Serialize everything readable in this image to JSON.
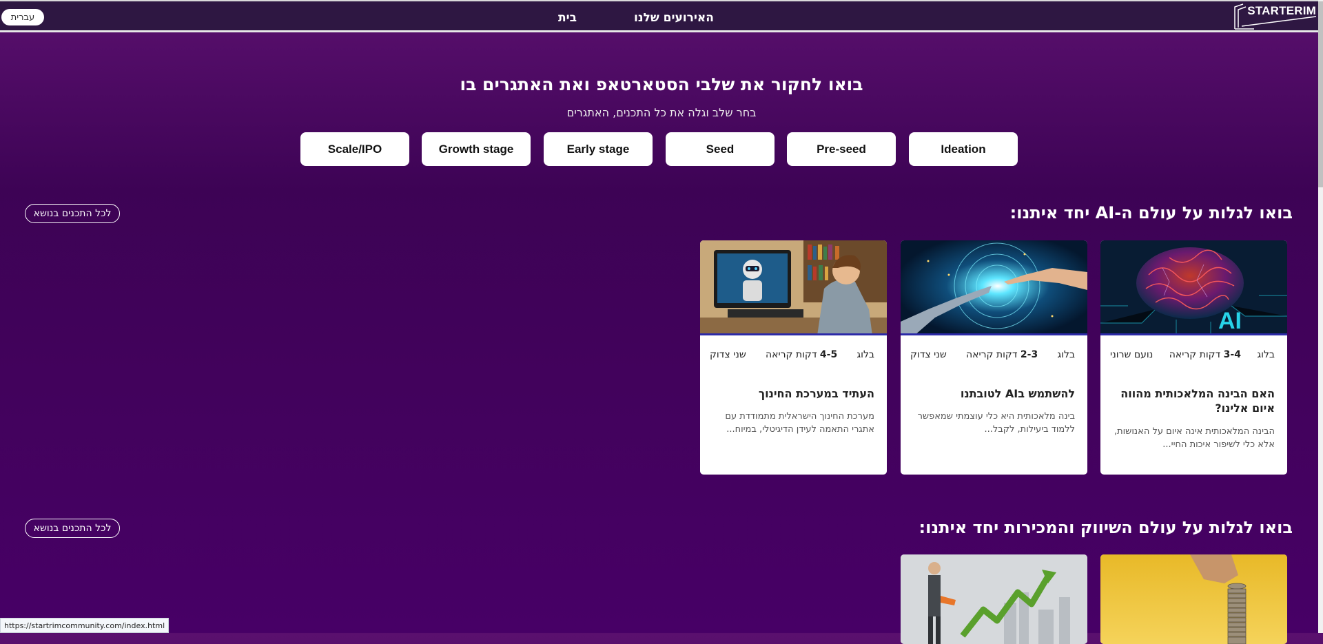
{
  "header": {
    "lang_label": "עברית",
    "nav": [
      "האירועים שלנו",
      "בית"
    ],
    "logo_text": "STARTERIM"
  },
  "hero": {
    "title": "בואו לחקור את שלבי הסטארטאפ ואת האתגרים בו",
    "subtitle": "בחר שלב וגלה את כל התכנים, האתגרים",
    "stages": [
      "Scale/IPO",
      "Growth stage",
      "Early stage",
      "Seed",
      "Pre-seed",
      "Ideation"
    ]
  },
  "sections": [
    {
      "title": "בואו לגלות על עולם ה-AI יחד איתנו:",
      "all_label": "לכל התכנים בנושא",
      "cards": [
        {
          "tag": "בלוג",
          "time_num": "3-4",
          "time_label": "דקות קריאה",
          "author": "נועם שרוני",
          "title": "האם הבינה המלאכותית מהווה איום אלינו?",
          "desc": "הבינה המלאכותית אינה איום על האנושות, אלא כלי לשיפור איכות החיי...",
          "image_icon": "ai-brain-icon"
        },
        {
          "tag": "בלוג",
          "time_num": "2-3",
          "time_label": "דקות קריאה",
          "author": "שני צדוק",
          "title": "להשתמש בAI לטובתנו",
          "desc": "בינה מלאכותית היא כלי עוצמתי שמאפשר ללמוד ביעילות, לקבל...",
          "image_icon": "robot-hand-icon"
        },
        {
          "tag": "בלוג",
          "time_num": "4-5",
          "time_label": "דקות קריאה",
          "author": "שני צדוק",
          "title": "העתיד במערכת החינוך",
          "desc": "מערכת החינוך הישראלית מתמודדת עם אתגרי התאמה לעידן הדיגיטלי, במיוח...",
          "image_icon": "robot-classroom-icon"
        }
      ]
    },
    {
      "title": "בואו לגלות על עולם השיווק והמכירות יחד איתנו:",
      "all_label": "לכל התכנים בנושא",
      "cards": [
        {
          "image_icon": "coins-stack-icon"
        },
        {
          "image_icon": "growth-arrow-icon"
        }
      ]
    }
  ],
  "status_bar": {
    "url": "https://startrimcommunity.com/index.html"
  }
}
